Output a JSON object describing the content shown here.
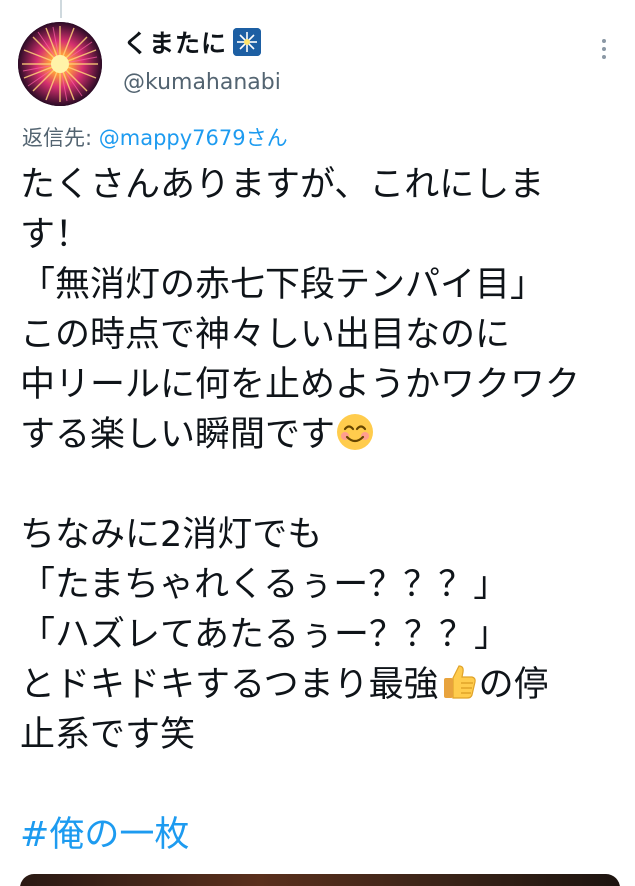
{
  "author": {
    "display_name": "くまたに",
    "handle": "@kumahanabi",
    "avatar_icon": "firework-avatar-icon",
    "badge_icon": "fireworks-emoji-icon"
  },
  "menu": {
    "more_icon": "more-vertical-icon"
  },
  "reply": {
    "prefix": "返信先: ",
    "mention": "@mappy7679さん"
  },
  "tweet": {
    "lines": [
      "たくさんありますが、これにしま",
      "す！",
      "「無消灯の赤七下段テンパイ目」",
      "この時点で神々しい出目なのに",
      "中リールに何を止めようかワクワク",
      "する楽しい瞬間です",
      "",
      "ちなみに2消灯でも",
      "「たまちゃれくるぅー？？？」",
      "「ハズレてあたるぅー？？？」",
      "とドキドキするつまり最強",
      "止系です笑",
      "",
      "#俺の一枚"
    ],
    "line11_suffix": "の停",
    "emojis": {
      "smile": "smiling-face-emoji-icon",
      "thumbs_up": "thumbs-up-emoji-icon"
    }
  },
  "colors": {
    "link": "#1d9bf0",
    "secondary_text": "#536471",
    "primary_text": "#0f1419"
  }
}
